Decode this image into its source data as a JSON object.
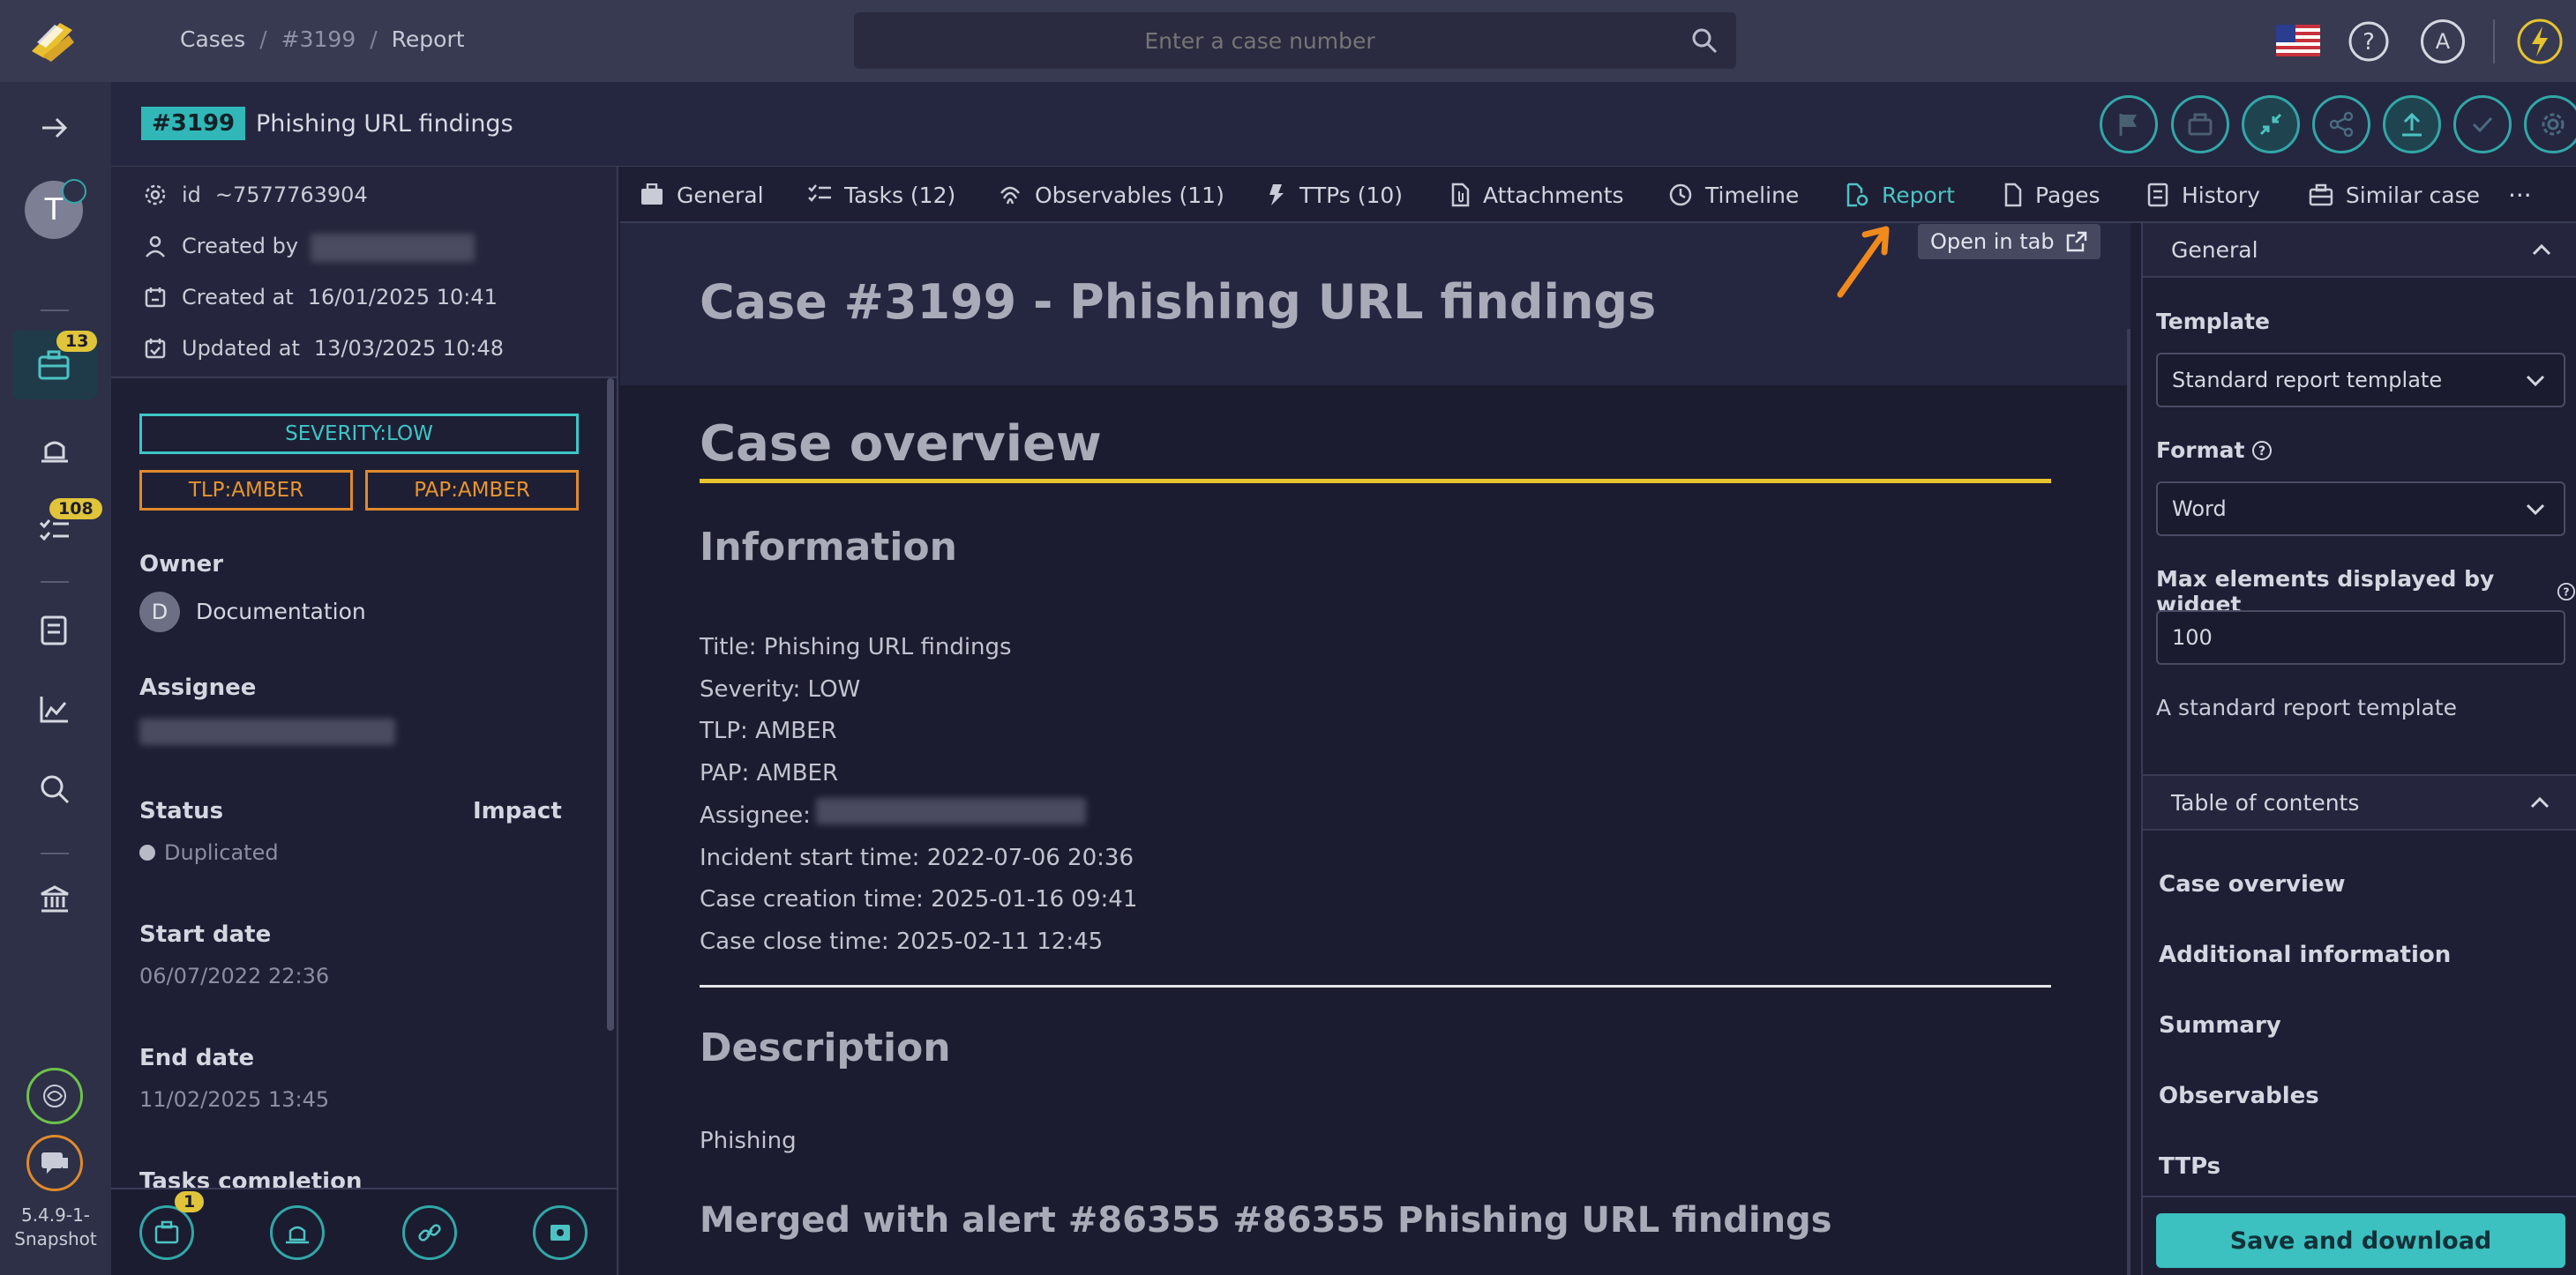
{
  "topbar": {
    "breadcrumb": [
      "Cases",
      "#3199",
      "Report"
    ],
    "search_placeholder": "Enter a case number",
    "user_initial": "A"
  },
  "leftnav": {
    "user_initial": "T",
    "cases_badge": "13",
    "tasks_badge": "108",
    "version": "5.4.9-1-",
    "version2": "Snapshot"
  },
  "case": {
    "number": "#3199",
    "title": "Phishing URL findings"
  },
  "details": {
    "id_label": "id",
    "id_value": "~7577763904",
    "created_by_label": "Created by",
    "created_at_label": "Created at",
    "created_at_value": "16/01/2025 10:41",
    "updated_at_label": "Updated at",
    "updated_at_value": "13/03/2025 10:48",
    "severity": "SEVERITY:LOW",
    "tlp": "TLP:AMBER",
    "pap": "PAP:AMBER",
    "owner_label": "Owner",
    "owner_initial": "D",
    "owner_name": "Documentation",
    "assignee_label": "Assignee",
    "status_label": "Status",
    "impact_label": "Impact",
    "status_value": "Duplicated",
    "start_label": "Start date",
    "start_value": "06/07/2022 22:36",
    "end_label": "End date",
    "end_value": "11/02/2025 13:45",
    "tasks_completion_label": "Tasks completion",
    "bottom_badge": "1"
  },
  "tabs": [
    {
      "label": "General"
    },
    {
      "label": "Tasks (12)"
    },
    {
      "label": "Observables (11)"
    },
    {
      "label": "TTPs (10)"
    },
    {
      "label": "Attachments"
    },
    {
      "label": "Timeline"
    },
    {
      "label": "Report"
    },
    {
      "label": "Pages"
    },
    {
      "label": "History"
    },
    {
      "label": "Similar case"
    }
  ],
  "tooltip": "Open in tab",
  "report": {
    "title": "Case #3199 - Phishing URL findings",
    "overview": "Case overview",
    "information": "Information",
    "lines": [
      "Title: Phishing URL findings",
      "Severity: LOW",
      "TLP: AMBER",
      "PAP: AMBER",
      "Assignee:",
      "Incident start time: 2022-07-06 20:36",
      "Case creation time: 2025-01-16 09:41",
      "Case close time: 2025-02-11 12:45"
    ],
    "description": "Description",
    "description_text": "Phishing",
    "merged": "Merged with alert #86355 #86355 Phishing URL findings"
  },
  "side": {
    "general_header": "General",
    "template_label": "Template",
    "template_value": "Standard report template",
    "format_label": "Format",
    "format_value": "Word",
    "max_label": "Max elements displayed by widget",
    "max_value": "100",
    "template_desc": "A standard report template",
    "toc_header": "Table of contents",
    "toc_items": [
      "Case overview",
      "Additional information",
      "Summary",
      "Observables",
      "TTPs"
    ],
    "save_button": "Save and download"
  },
  "colors": {
    "accent": "#31a7a7",
    "amber": "#e08a2a",
    "severity": "#3cc6c6",
    "yellow_rule": "#e6c42e"
  }
}
